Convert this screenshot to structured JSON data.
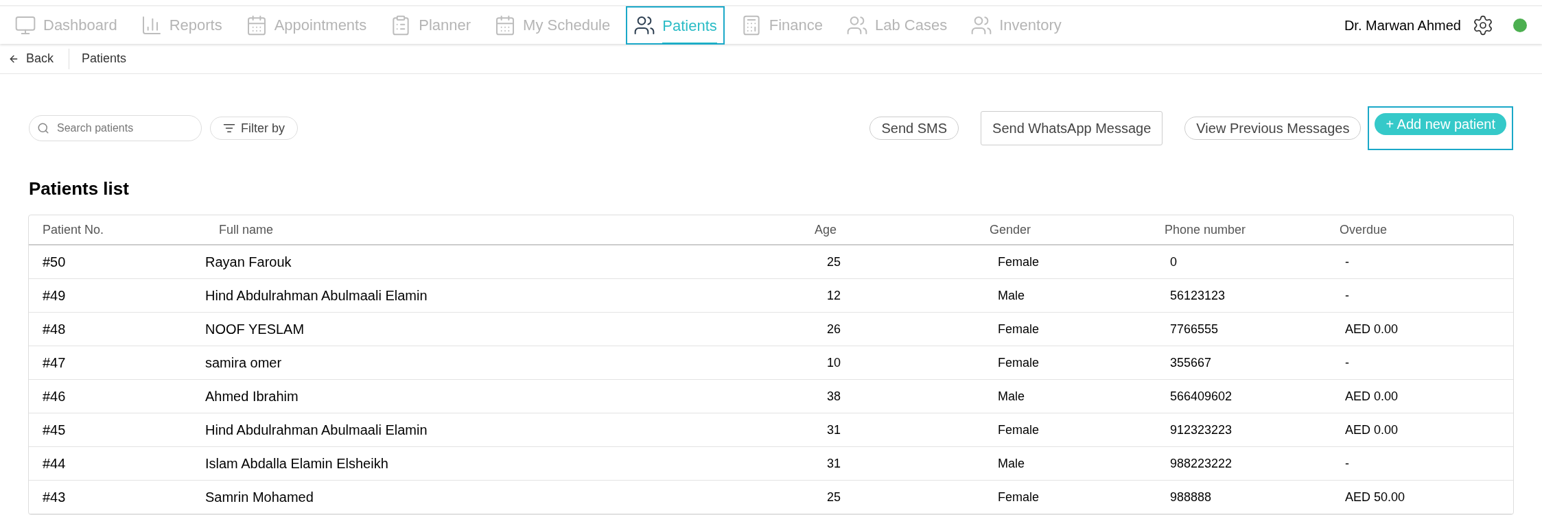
{
  "nav": {
    "items": [
      {
        "label": "Dashboard",
        "selected": false
      },
      {
        "label": "Reports",
        "selected": false
      },
      {
        "label": "Appointments",
        "selected": false
      },
      {
        "label": "Planner",
        "selected": false
      },
      {
        "label": "My Schedule",
        "selected": false
      },
      {
        "label": "Patients",
        "selected": true
      },
      {
        "label": "Finance",
        "selected": false
      },
      {
        "label": "Lab Cases",
        "selected": false
      },
      {
        "label": "Inventory",
        "selected": false
      }
    ],
    "user": "Dr. Marwan Ahmed",
    "online": true
  },
  "breadcrumb": {
    "back": "Back",
    "items": [
      "Patients"
    ]
  },
  "toolbar": {
    "search": {
      "placeholder": "Search patients"
    },
    "filter": "Filter by",
    "buttons": [
      {
        "label": "Send SMS",
        "kind": "pill"
      },
      {
        "label": "Send WhatsApp Message",
        "kind": "box"
      },
      {
        "label": "View Previous Messages",
        "kind": "pill"
      },
      {
        "label": "+ Add new patient",
        "kind": "primary"
      }
    ]
  },
  "table": {
    "title": "Patients list",
    "columns": [
      "Patient No.",
      "Full name",
      "Age",
      "Gender",
      "Phone number",
      "Overdue"
    ],
    "rows": [
      [
        "#50",
        "Rayan Farouk",
        "25",
        "Female",
        "0",
        "-"
      ],
      [
        "#49",
        "Hind Abdulrahman Abulmaali Elamin",
        "12",
        "Male",
        "56123123",
        "-"
      ],
      [
        "#48",
        "NOOF YESLAM",
        "26",
        "Female",
        "7766555",
        "AED 0.00"
      ],
      [
        "#47",
        "samira omer",
        "10",
        "Female",
        "355667",
        "-"
      ],
      [
        "#46",
        "Ahmed Ibrahim",
        "38",
        "Male",
        "566409602",
        "AED 0.00"
      ],
      [
        "#45",
        "Hind Abdulrahman Abulmaali Elamin",
        "31",
        "Female",
        "912323223",
        "AED 0.00"
      ],
      [
        "#44",
        "Islam Abdalla Elamin Elsheikh",
        "31",
        "Male",
        "988223222",
        "-"
      ],
      [
        "#43",
        "Samrin Mohamed",
        "25",
        "Female",
        "988888",
        "AED 50.00"
      ]
    ]
  }
}
